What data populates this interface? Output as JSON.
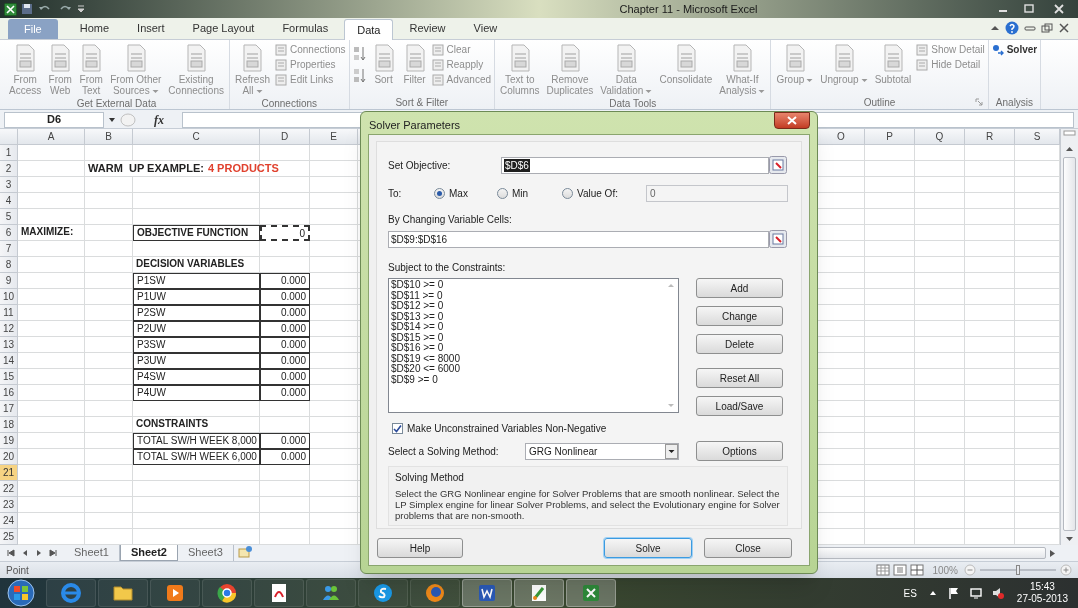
{
  "title_bar": {
    "title": "Chapter 11 - Microsoft Excel"
  },
  "ribbon_tabs": [
    {
      "label": "File",
      "kind": "file",
      "selected": false
    },
    {
      "label": "Home",
      "kind": "tab",
      "selected": false
    },
    {
      "label": "Insert",
      "kind": "tab",
      "selected": false
    },
    {
      "label": "Page Layout",
      "kind": "tab",
      "selected": false
    },
    {
      "label": "Formulas",
      "kind": "tab",
      "selected": false
    },
    {
      "label": "Data",
      "kind": "tab",
      "selected": true
    },
    {
      "label": "Review",
      "kind": "tab",
      "selected": false
    },
    {
      "label": "View",
      "kind": "tab",
      "selected": false
    }
  ],
  "ribbon_groups": [
    {
      "label": "Get External Data",
      "launcher": false,
      "items": [
        {
          "kind": "large",
          "label": "From\nAccess",
          "disabled": true
        },
        {
          "kind": "large",
          "label": "From\nWeb",
          "disabled": true
        },
        {
          "kind": "large",
          "label": "From\nText",
          "disabled": true
        },
        {
          "kind": "large",
          "label": "From Other\nSources",
          "dropdown": true,
          "disabled": true
        },
        {
          "kind": "large",
          "label": "Existing\nConnections",
          "disabled": true
        }
      ]
    },
    {
      "label": "Connections",
      "launcher": false,
      "items": [
        {
          "kind": "large",
          "label": "Refresh\nAll",
          "dropdown": true,
          "disabled": true
        },
        {
          "kind": "stack",
          "items": [
            {
              "label": "Connections",
              "disabled": true
            },
            {
              "label": "Properties",
              "disabled": true
            },
            {
              "label": "Edit Links",
              "disabled": true
            }
          ]
        }
      ]
    },
    {
      "label": "Sort & Filter",
      "launcher": false,
      "items": [
        {
          "kind": "sort-pair"
        },
        {
          "kind": "large",
          "label": "Sort",
          "disabled": true
        },
        {
          "kind": "large",
          "label": "Filter",
          "disabled": true
        },
        {
          "kind": "stack",
          "items": [
            {
              "label": "Clear",
              "disabled": true
            },
            {
              "label": "Reapply",
              "disabled": true
            },
            {
              "label": "Advanced",
              "disabled": true
            }
          ]
        }
      ]
    },
    {
      "label": "Data Tools",
      "launcher": false,
      "items": [
        {
          "kind": "large",
          "label": "Text to\nColumns",
          "disabled": true
        },
        {
          "kind": "large",
          "label": "Remove\nDuplicates",
          "disabled": true
        },
        {
          "kind": "large",
          "label": "Data\nValidation",
          "dropdown": true,
          "disabled": true
        },
        {
          "kind": "large",
          "label": "Consolidate",
          "disabled": true
        },
        {
          "kind": "large",
          "label": "What-If\nAnalysis",
          "dropdown": true,
          "disabled": true
        }
      ]
    },
    {
      "label": "Outline",
      "launcher": true,
      "items": [
        {
          "kind": "large",
          "label": "Group",
          "dropdown": true,
          "disabled": true
        },
        {
          "kind": "large",
          "label": "Ungroup",
          "dropdown": true,
          "disabled": true
        },
        {
          "kind": "large",
          "label": "Subtotal",
          "disabled": true
        },
        {
          "kind": "stack",
          "items": [
            {
              "label": "Show Detail",
              "disabled": true
            },
            {
              "label": "Hide Detail",
              "disabled": true
            }
          ]
        }
      ]
    },
    {
      "label": "Analysis",
      "launcher": false,
      "items": [
        {
          "kind": "stack",
          "items": [
            {
              "label": "Solver",
              "disabled": false
            }
          ]
        }
      ]
    }
  ],
  "formula_bar": {
    "name_box": "D6",
    "function_label": "fx"
  },
  "sheet": {
    "columns_left": [
      "A",
      "B",
      "C",
      "D",
      "E"
    ],
    "columns_right": [
      "O",
      "P",
      "Q",
      "R",
      "S"
    ],
    "rows": [
      {
        "number": "1",
        "selected": false,
        "kind": "blank"
      },
      {
        "number": "2",
        "selected": false,
        "kind": "heading",
        "b": "WARM  UP EXAMPLE:",
        "highlight": "4 PRODUCTS"
      },
      {
        "number": "3",
        "selected": false,
        "kind": "blank"
      },
      {
        "number": "4",
        "selected": false,
        "kind": "blank"
      },
      {
        "number": "5",
        "selected": false,
        "kind": "blank"
      },
      {
        "number": "6",
        "selected": false,
        "kind": "objective",
        "a": "MAXIMIZE:",
        "c": "OBJECTIVE FUNCTION",
        "d": "0"
      },
      {
        "number": "7",
        "selected": false,
        "kind": "blank"
      },
      {
        "number": "8",
        "selected": false,
        "kind": "section",
        "c": "DECISION VARIABLES"
      },
      {
        "number": "9",
        "selected": false,
        "kind": "variable",
        "c": "P1SW",
        "d": "0.000"
      },
      {
        "number": "10",
        "selected": false,
        "kind": "variable",
        "c": "P1UW",
        "d": "0.000"
      },
      {
        "number": "11",
        "selected": false,
        "kind": "variable",
        "c": "P2SW",
        "d": "0.000"
      },
      {
        "number": "12",
        "selected": false,
        "kind": "variable",
        "c": "P2UW",
        "d": "0.000"
      },
      {
        "number": "13",
        "selected": false,
        "kind": "variable",
        "c": "P3SW",
        "d": "0.000"
      },
      {
        "number": "14",
        "selected": false,
        "kind": "variable",
        "c": "P3UW",
        "d": "0.000"
      },
      {
        "number": "15",
        "selected": false,
        "kind": "variable",
        "c": "P4SW",
        "d": "0.000"
      },
      {
        "number": "16",
        "selected": false,
        "kind": "variable",
        "c": "P4UW",
        "d": "0.000"
      },
      {
        "number": "17",
        "selected": false,
        "kind": "blank"
      },
      {
        "number": "18",
        "selected": false,
        "kind": "section",
        "c": "CONSTRAINTS"
      },
      {
        "number": "19",
        "selected": false,
        "kind": "variable",
        "c": "TOTAL SW/H WEEK 8,000",
        "d": "0.000"
      },
      {
        "number": "20",
        "selected": false,
        "kind": "variable",
        "c": "TOTAL SW/H WEEK 6,000",
        "d": "0.000"
      },
      {
        "number": "21",
        "selected": true,
        "kind": "blank"
      },
      {
        "number": "22",
        "selected": false,
        "kind": "blank"
      },
      {
        "number": "23",
        "selected": false,
        "kind": "blank"
      },
      {
        "number": "24",
        "selected": false,
        "kind": "blank"
      },
      {
        "number": "25",
        "selected": false,
        "kind": "blank"
      }
    ]
  },
  "sheet_tabs": [
    {
      "label": "Sheet1",
      "selected": false
    },
    {
      "label": "Sheet2",
      "selected": true
    },
    {
      "label": "Sheet3",
      "selected": false
    }
  ],
  "status_bar": {
    "mode": "Point",
    "zoom": {
      "reading": "100%",
      "level": 0.5
    }
  },
  "dialog": {
    "title": "Solver Parameters",
    "objective": {
      "label": "Set Objective:",
      "value": "$D$6"
    },
    "to": {
      "label": "To:",
      "options": [
        {
          "label": "Max",
          "selected": true
        },
        {
          "label": "Min",
          "selected": false
        },
        {
          "label": "Value Of:",
          "selected": false
        }
      ],
      "value": "0"
    },
    "variables": {
      "label": "By Changing Variable Cells:",
      "value": "$D$9:$D$16"
    },
    "constraints": {
      "label": "Subject to the Constraints:",
      "items": [
        "$D$10 >= 0",
        "$D$11 >= 0",
        "$D$12 >= 0",
        "$D$13 >= 0",
        "$D$14 >= 0",
        "$D$15 >= 0",
        "$D$16 >= 0",
        "$D$19 <= 8000",
        "$D$20 <= 6000",
        "$D$9 >= 0"
      ]
    },
    "constraint_buttons": [
      "Add",
      "Change",
      "Delete",
      "Reset All",
      "Load/Save"
    ],
    "non_negative": {
      "label": "Make Unconstrained Variables Non-Negative",
      "checked": true
    },
    "method": {
      "label": "Select a Solving Method:",
      "value": "GRG Nonlinear"
    },
    "options_button": "Options",
    "solving_method": {
      "title": "Solving Method",
      "description": "Select the GRG Nonlinear engine for Solver Problems that are smooth nonlinear. Select the LP Simplex engine for linear Solver Problems, and select the Evolutionary engine for Solver problems that are non-smooth."
    },
    "buttons": [
      {
        "label": "Help",
        "default": false
      },
      {
        "label": "Solve",
        "default": true
      },
      {
        "label": "Close",
        "default": false
      }
    ]
  },
  "taskbar": {
    "language": "ES",
    "time": "15:43",
    "date": "27-05-2013"
  }
}
